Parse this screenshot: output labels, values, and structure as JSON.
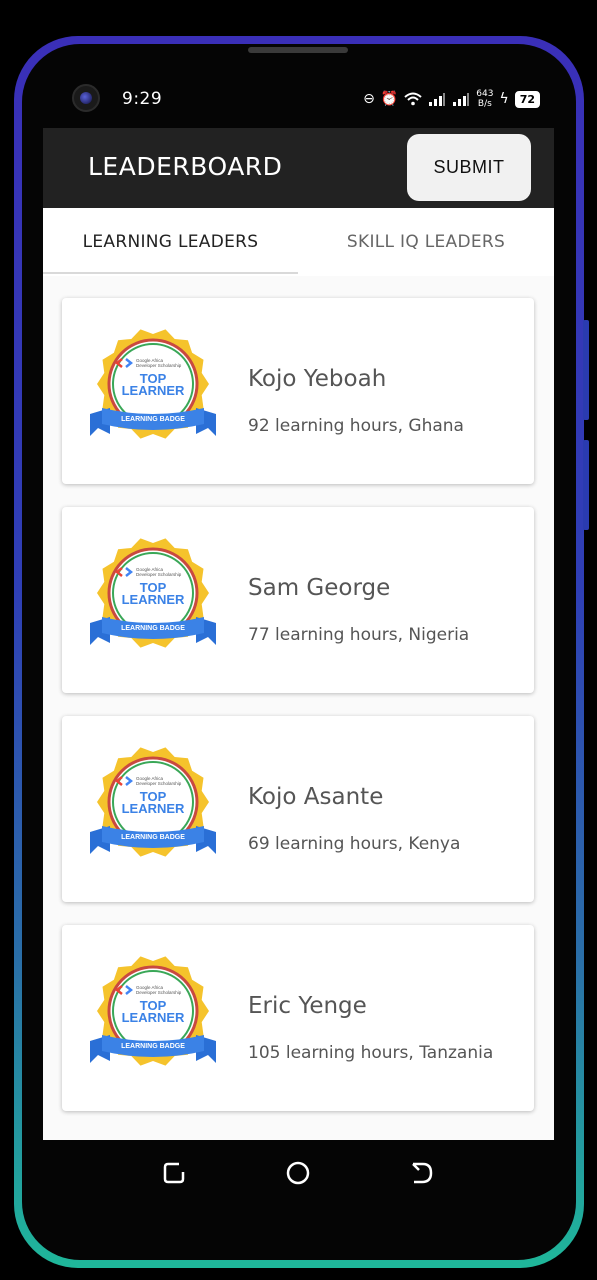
{
  "status_bar": {
    "time": "9:29",
    "net_speed_value": "643",
    "net_speed_unit": "B/s",
    "battery": "72"
  },
  "app_bar": {
    "title": "LEADERBOARD",
    "submit_label": "SUBMIT"
  },
  "tabs": [
    {
      "label": "LEARNING LEADERS",
      "selected": true
    },
    {
      "label": "SKILL IQ LEADERS",
      "selected": false
    }
  ],
  "badge": {
    "line1": "TOP",
    "line2": "LEARNER",
    "ribbon": "LEARNING BADGE",
    "org_line1": "Google Africa",
    "org_line2": "Developer Scholarship"
  },
  "leaders": [
    {
      "name": "Kojo Yeboah",
      "details": "92 learning hours, Ghana"
    },
    {
      "name": "Sam George",
      "details": "77 learning hours, Nigeria"
    },
    {
      "name": "Kojo Asante",
      "details": "69 learning hours, Kenya"
    },
    {
      "name": "Eric Yenge",
      "details": "105 learning hours, Tanzania"
    }
  ],
  "colors": {
    "app_bar": "#222222",
    "badge_gold": "#f5c32c",
    "badge_blue": "#3b82e6",
    "frame_top": "#3a2fb8",
    "frame_bottom": "#1fb79a"
  }
}
